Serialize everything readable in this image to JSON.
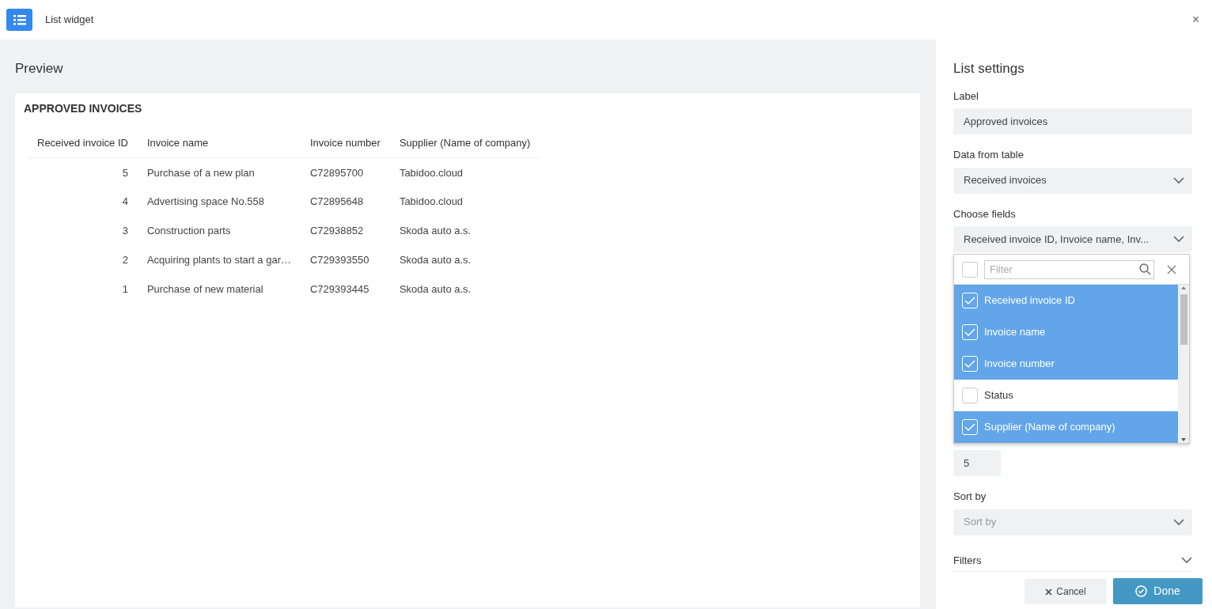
{
  "window": {
    "title": "List widget",
    "close": "×"
  },
  "preview": {
    "title": "Preview",
    "list_title": "APPROVED INVOICES",
    "columns": [
      "Received invoice ID",
      "Invoice name",
      "Invoice number",
      "Supplier (Name of company)"
    ],
    "rows": [
      [
        "5",
        "Purchase of a new plan",
        "C72895700",
        "Tabidoo.cloud"
      ],
      [
        "4",
        "Advertising space No.558",
        "C72895648",
        "Tabidoo.cloud"
      ],
      [
        "3",
        "Construction parts",
        "C72938852",
        "Skoda auto a.s."
      ],
      [
        "2",
        "Acquiring plants to start a gar…",
        "C729393550",
        "Skoda auto a.s."
      ],
      [
        "1",
        "Purchase of new material",
        "C729393445",
        "Skoda auto a.s."
      ]
    ]
  },
  "settings": {
    "title": "List settings",
    "fields": [
      {
        "kind": "text",
        "label": "Label",
        "value": "Approved invoices"
      },
      {
        "kind": "select",
        "label": "Data from table",
        "value": "Received invoices"
      },
      {
        "kind": "multiselect",
        "label": "Choose fields",
        "value": "Received invoice ID, Invoice name, Inv...",
        "dropdown": {
          "placeholder": "Filter",
          "select_all_checked": false,
          "options": [
            {
              "label": "Received invoice ID",
              "checked": true
            },
            {
              "label": "Invoice name",
              "checked": true
            },
            {
              "label": "Invoice number",
              "checked": true
            },
            {
              "label": "Status",
              "checked": false
            },
            {
              "label": "Supplier (Name of company)",
              "checked": true
            }
          ]
        }
      },
      {
        "kind": "number",
        "value": "5"
      },
      {
        "kind": "select",
        "label": "Sort by",
        "placeholder": "Sort by"
      },
      {
        "kind": "section",
        "label": "Filters",
        "expanded": false
      }
    ]
  },
  "footer": {
    "cancel": "Cancel",
    "done": "Done"
  }
}
